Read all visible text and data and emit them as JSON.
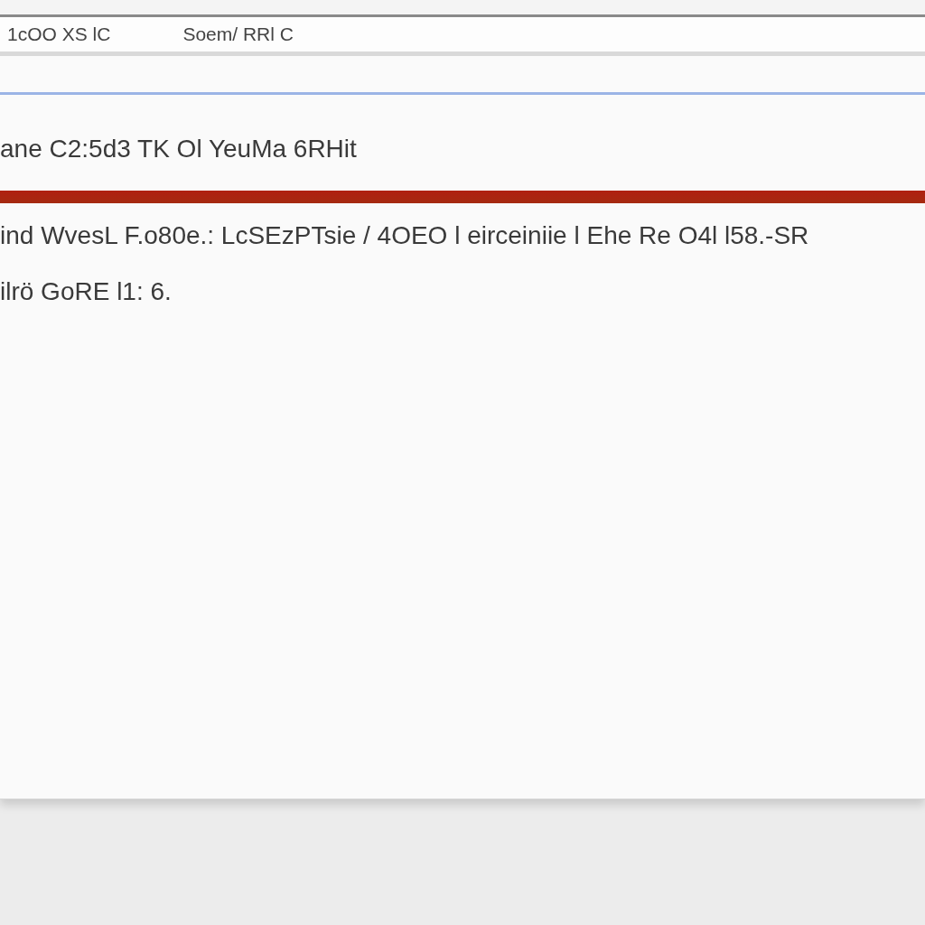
{
  "toolbar": {
    "items": [
      "1cOO XS lC",
      "Soem/ RRl C"
    ]
  },
  "heading": "ane C2:5d3 TK  Ol YeuMa 6RHit",
  "lines": [
    "ind WvesL F.o80e.: LcSEzPTsie / 4OEO l eirceiniie l Ehe  Re O4l l58.-SR",
    "ilrö GoRE  l1: 6."
  ]
}
